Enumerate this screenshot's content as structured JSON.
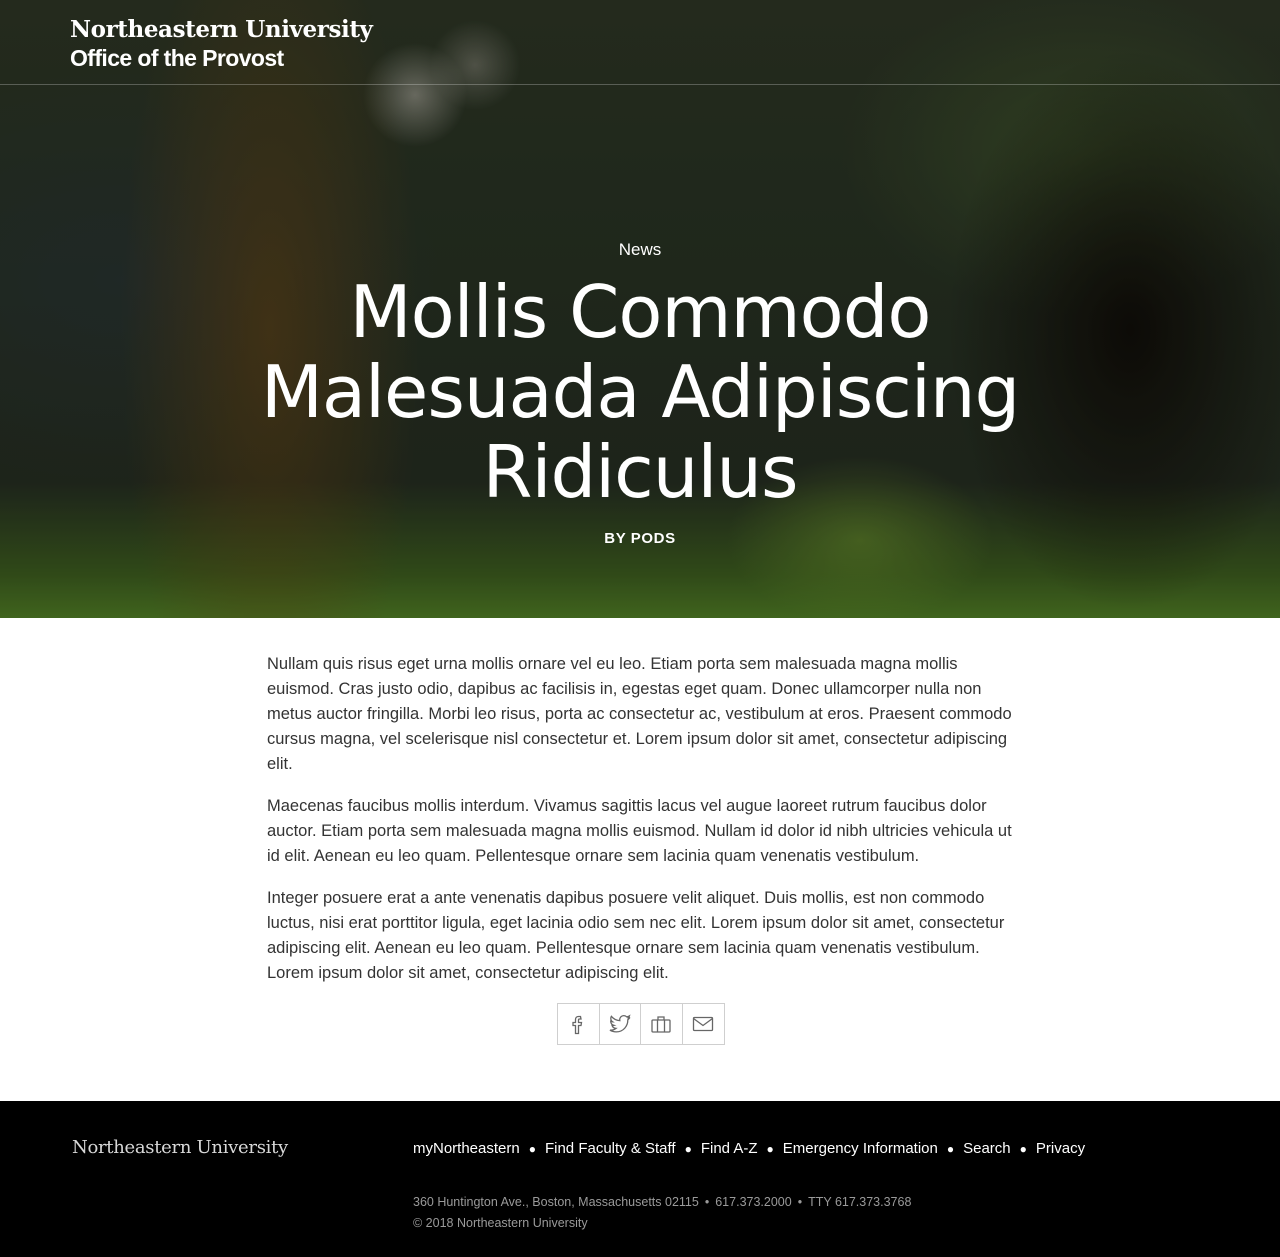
{
  "header": {
    "university": "Northeastern University",
    "office": "Office of the Provost"
  },
  "hero": {
    "category": "News",
    "title": "Mollis Commodo Malesuada Adipiscing Ridiculus",
    "byline": "BY PODS"
  },
  "article": {
    "paragraphs": [
      "Nullam quis risus eget urna mollis ornare vel eu leo. Etiam porta sem malesuada magna mollis euismod. Cras justo odio, dapibus ac facilisis in, egestas eget quam. Donec ullamcorper nulla non metus auctor fringilla. Morbi leo risus, porta ac consectetur ac, vestibulum at eros. Praesent commodo cursus magna, vel scelerisque nisl consectetur et. Lorem ipsum dolor sit amet, consectetur adipiscing elit.",
      "Maecenas faucibus mollis interdum. Vivamus sagittis lacus vel augue laoreet rutrum faucibus dolor auctor. Etiam porta sem malesuada magna mollis euismod. Nullam id dolor id nibh ultricies vehicula ut id elit. Aenean eu leo quam. Pellentesque ornare sem lacinia quam venenatis vestibulum.",
      "Integer posuere erat a ante venenatis dapibus posuere velit aliquet. Duis mollis, est non commodo luctus, nisi erat porttitor ligula, eget lacinia odio sem nec elit. Lorem ipsum dolor sit amet, consectetur adipiscing elit. Aenean eu leo quam. Pellentesque ornare sem lacinia quam venenatis vestibulum. Lorem ipsum dolor sit amet, consectetur adipiscing elit."
    ]
  },
  "share": {
    "icons": [
      "facebook-icon",
      "twitter-icon",
      "briefcase-icon",
      "email-icon"
    ]
  },
  "footer": {
    "logo": "Northeastern University",
    "nav": [
      "myNortheastern",
      "Find Faculty & Staff",
      "Find A-Z",
      "Emergency Information",
      "Search",
      "Privacy"
    ],
    "address": "360 Huntington Ave., Boston, Massachusetts 02115",
    "phone": "617.373.2000",
    "tty": "TTY 617.373.3768",
    "copyright": "© 2018 Northeastern University"
  },
  "colors": {
    "footer_bg": "#000000",
    "text": "#333333",
    "share_border": "#cfcfcf"
  }
}
